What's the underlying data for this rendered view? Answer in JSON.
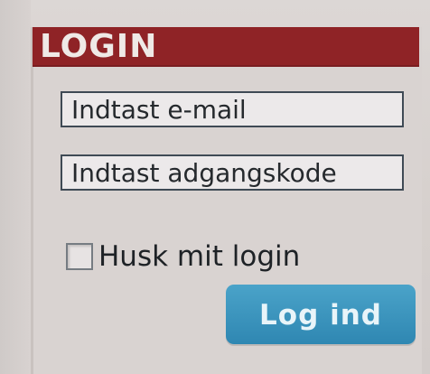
{
  "login": {
    "title": "LOGIN",
    "email": {
      "placeholder": "Indtast e-mail",
      "value": ""
    },
    "password": {
      "placeholder": "Indtast adgangskode",
      "value": ""
    },
    "remember": {
      "label": "Husk mit login",
      "checked": false
    },
    "submit_label": "Log ind"
  },
  "colors": {
    "header_bg": "#8f2326",
    "header_text": "#efe9e6",
    "input_border": "#3f4a55",
    "button_bg": "#3a95bf",
    "button_text": "#e8f4f9",
    "page_bg": "#d9d4d2"
  }
}
